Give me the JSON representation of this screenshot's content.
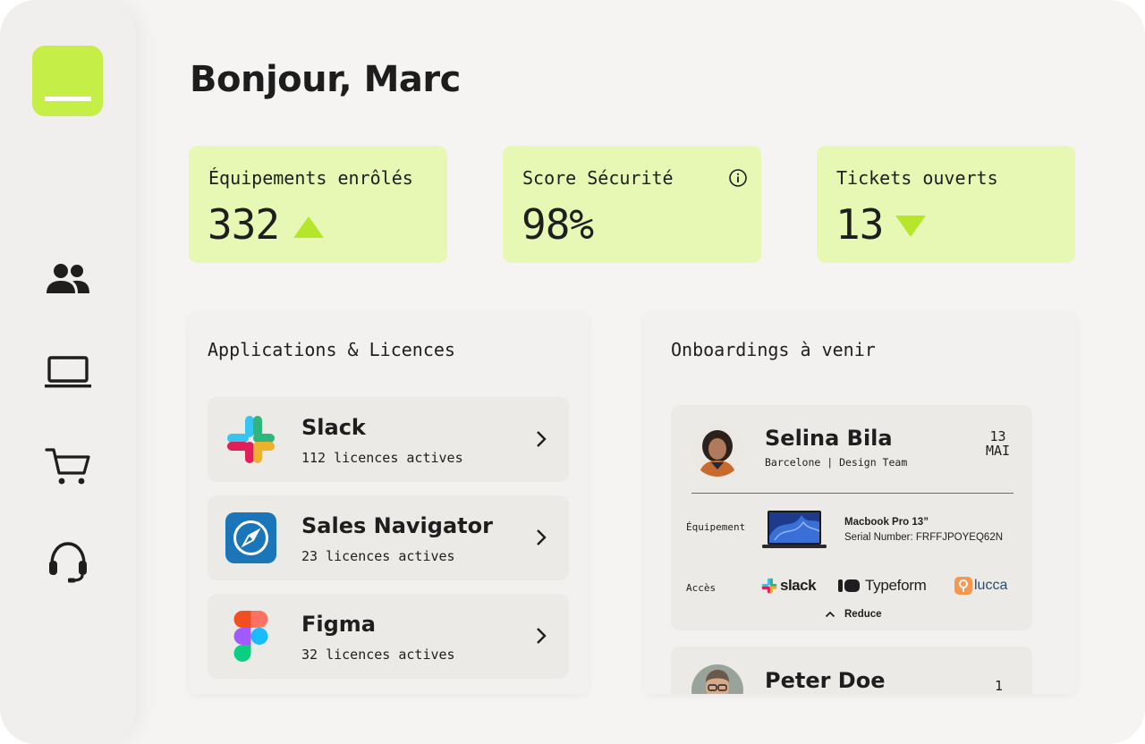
{
  "brand": {
    "accent": "#c5ef47",
    "card_bg": "#e6f8b4",
    "arrow": "#b6e62a"
  },
  "sidebar": {
    "logo": "logo-mark",
    "items": [
      {
        "icon": "users-icon"
      },
      {
        "icon": "laptop-icon"
      },
      {
        "icon": "cart-icon"
      },
      {
        "icon": "headset-icon"
      }
    ]
  },
  "greeting": "Bonjour, Marc",
  "stats": [
    {
      "label": "Équipements enrôlés",
      "value": "332",
      "trend": "up"
    },
    {
      "label": "Score Sécurité",
      "value": "98%",
      "icon": "info-icon"
    },
    {
      "label": "Tickets ouverts",
      "value": "13",
      "trend": "down"
    }
  ],
  "apps_panel": {
    "title": "Applications & Licences",
    "items": [
      {
        "name": "Slack",
        "sub": "112 licences actives",
        "icon": "slack-logo"
      },
      {
        "name": "Sales Navigator",
        "sub": "23 licences actives",
        "icon": "compass-logo"
      },
      {
        "name": "Figma",
        "sub": "32 licences actives",
        "icon": "figma-logo"
      }
    ]
  },
  "onboarding_panel": {
    "title": "Onboardings à venir",
    "cards": [
      {
        "name": "Selina Bila",
        "sub": "Barcelone | Design Team",
        "date_day": "13",
        "date_month": "MAI",
        "equipment_label": "Équipement",
        "equipment_name": "Macbook Pro 13”",
        "serial": "Serial Number: FRFFJPOYEQ62N",
        "access_label": "Accès",
        "access": [
          "slack",
          "Typeform",
          "lucca"
        ],
        "reduce_label": "Reduce"
      },
      {
        "name": "Peter Doe",
        "date_day": "1"
      }
    ]
  }
}
